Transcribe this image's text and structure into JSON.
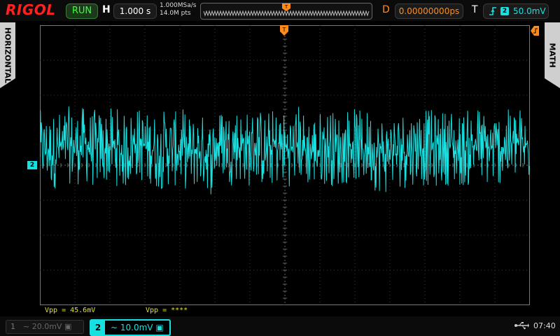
{
  "brand": "RIGOL",
  "status": "RUN",
  "horizontal": {
    "label": "H",
    "timebase": "1.000 s",
    "sample_rate": "1.000MSa/s",
    "memory_depth": "14.0M pts"
  },
  "delay": {
    "label": "D",
    "value": "0.00000000ps"
  },
  "trigger": {
    "label": "T",
    "source": "2",
    "level": "50.0mV",
    "edge_icon": "rising-edge-icon"
  },
  "side_tabs": {
    "left": "HORIZONTAL",
    "right": "MATH"
  },
  "channel_marker": "2",
  "measurements": [
    "Vpp = 45.6mV",
    "Vpp = ****"
  ],
  "channels": [
    {
      "number": "1",
      "coupling_icon": "~",
      "scale": "20.0mV",
      "active": false
    },
    {
      "number": "2",
      "coupling_icon": "~",
      "scale": "10.0mV",
      "active": true
    }
  ],
  "clock": "07:40",
  "colors": {
    "ch2": "#18e0e0",
    "trigger": "#ff8c1a",
    "brand": "#ff2020",
    "run": "#3dff3d",
    "measure": "#e8e020"
  }
}
